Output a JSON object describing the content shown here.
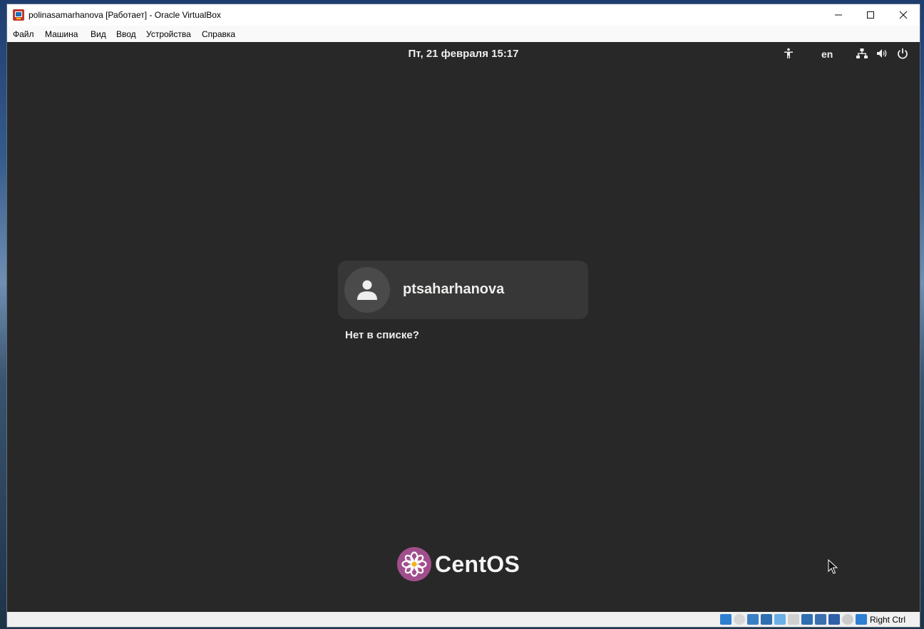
{
  "window": {
    "title": "polinasamarhanova [Работает] - Oracle VirtualBox",
    "menu": [
      "Файл",
      "Машина",
      "Вид",
      "Ввод",
      "Устройства",
      "Справка"
    ]
  },
  "vm": {
    "top_bar": {
      "datetime": "Пт, 21 февраля  15:17",
      "keyboard_layout": "en",
      "icons": [
        "accessibility-icon",
        "network-icon",
        "volume-icon",
        "power-icon"
      ]
    },
    "login": {
      "username": "ptsaharhanova",
      "not_listed": "Нет в списке?"
    },
    "branding": {
      "logo_text": "CentOS"
    }
  },
  "statusbar": {
    "host_key": "Right Ctrl"
  },
  "colors": {
    "vm_background": "#282828",
    "card_background": "#373737",
    "centos_purple": "#a14f8c",
    "text_light": "#eeeeec"
  }
}
